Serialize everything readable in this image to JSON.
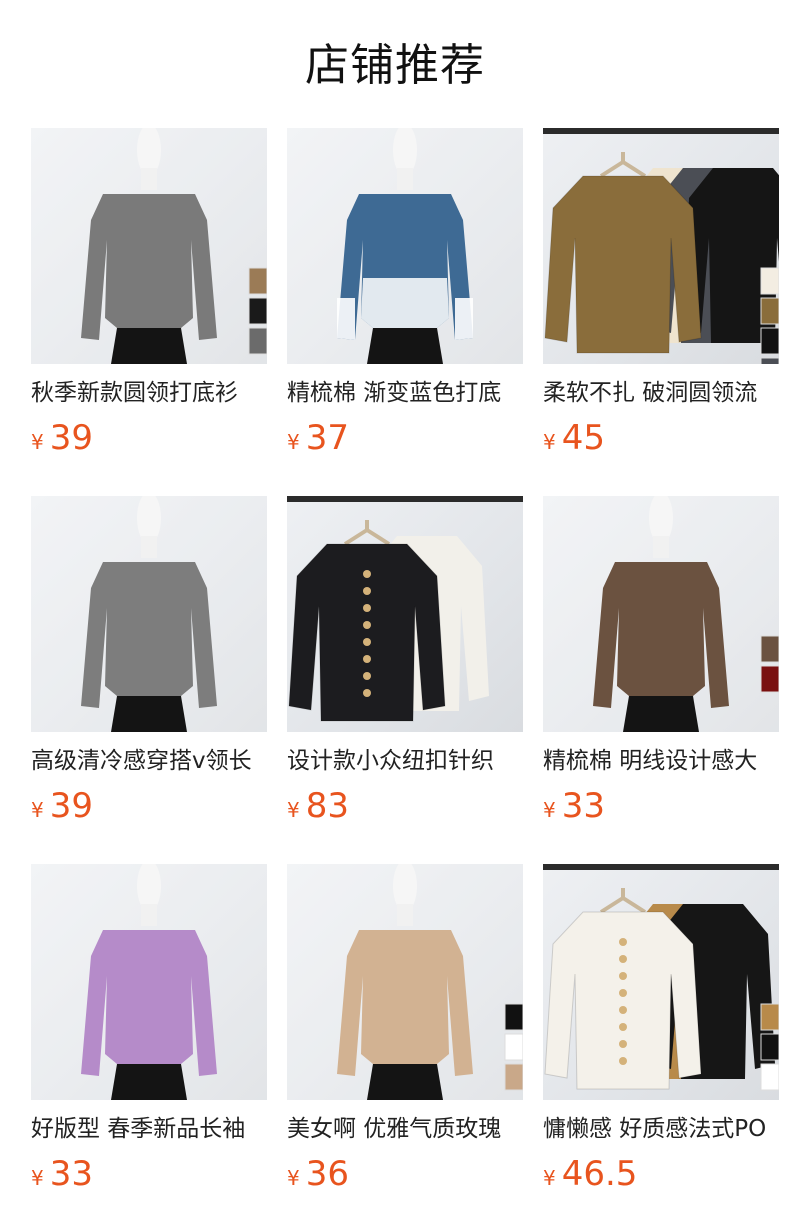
{
  "header": {
    "title": "店铺推荐"
  },
  "currency_symbol": "¥",
  "products": [
    {
      "name": "秋季新款圆领打底衫",
      "price": "39",
      "color": "#7a7a7a",
      "style": "mannequin",
      "swatches": [
        "#9b7b56",
        "#1a1a1a",
        "#6b6b6b"
      ]
    },
    {
      "name": "精梳棉 渐变蓝色打底",
      "price": "37",
      "color": "#3e6a94",
      "style": "gradient",
      "swatches": []
    },
    {
      "name": "柔软不扎 破洞圆领流",
      "price": "45",
      "color": "#8a6d3b",
      "style": "hanger",
      "swatches": [
        "#f3ede2",
        "#8a6d3b",
        "#111111",
        "#4b4e55"
      ]
    },
    {
      "name": "高级清冷感穿搭v领长",
      "price": "39",
      "color": "#7d7d7d",
      "style": "mannequin",
      "swatches": []
    },
    {
      "name": "设计款小众纽扣针织",
      "price": "83",
      "color": "#1c1c1f",
      "style": "hanger-cardigan",
      "swatches": []
    },
    {
      "name": "精梳棉 明线设计感大",
      "price": "33",
      "color": "#6b5240",
      "style": "mannequin",
      "swatches": [
        "#6b5240",
        "#7a1010"
      ]
    },
    {
      "name": "好版型 春季新品长袖",
      "price": "33",
      "color": "#b58bc9",
      "style": "mannequin",
      "swatches": []
    },
    {
      "name": "美女啊 优雅气质玫瑰",
      "price": "36",
      "color": "#d2b292",
      "style": "mannequin",
      "swatches": [
        "#111111",
        "#ffffff",
        "#c9a889"
      ]
    },
    {
      "name": "慵懒感 好质感法式PO",
      "price": "46.5",
      "color": "#f4f1ea",
      "style": "hanger-polo",
      "swatches": [
        "#b88a4a",
        "#111111",
        "#ffffff"
      ]
    }
  ]
}
